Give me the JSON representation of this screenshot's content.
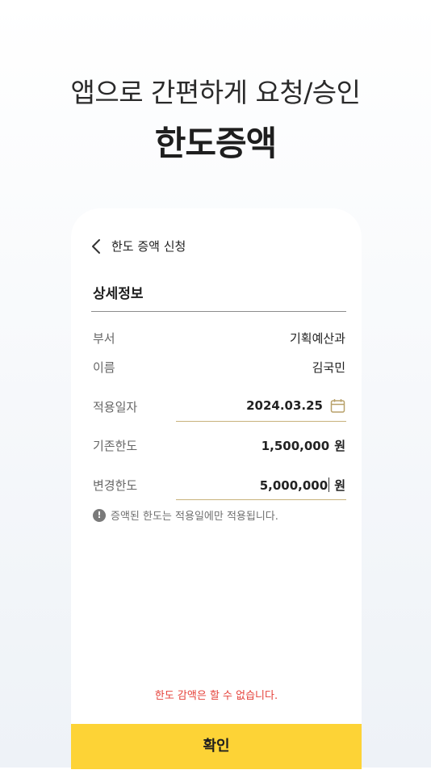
{
  "promo": {
    "subtitle": "앱으로 간편하게 요청/승인",
    "title": "한도증액"
  },
  "header": {
    "back_icon": "chevron-left-icon",
    "title": "한도 증액 신청"
  },
  "section": {
    "title": "상세정보"
  },
  "rows": {
    "department": {
      "label": "부서",
      "value": "기획예산과"
    },
    "name": {
      "label": "이름",
      "value": "김국민"
    },
    "apply_date": {
      "label": "적용일자",
      "value": "2024.03.25",
      "icon": "calendar-icon"
    },
    "current_limit": {
      "label": "기존한도",
      "value": "1,500,000",
      "unit": "원"
    },
    "new_limit": {
      "label": "변경한도",
      "value": "5,000,000",
      "unit": "원"
    }
  },
  "notice": {
    "icon": "info-icon",
    "text": "증액된 한도는 적용일에만 적용됩니다."
  },
  "warning": "한도 감액은 할 수 없습니다.",
  "confirm_label": "확인",
  "colors": {
    "accent": "#fdd336",
    "warning": "#e5413a",
    "field_underline": "#c8b27c"
  }
}
